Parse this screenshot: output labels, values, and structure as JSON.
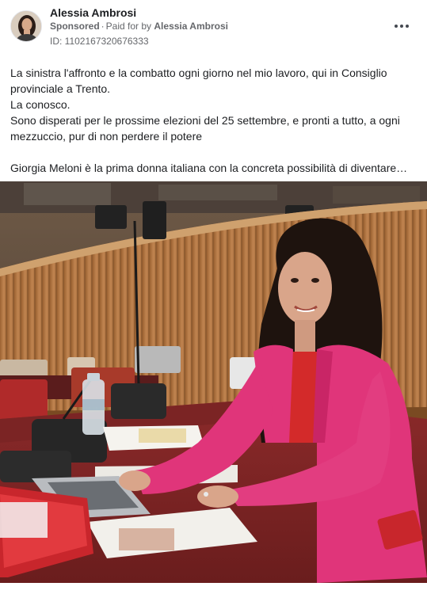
{
  "post": {
    "author": "Alessia Ambrosi",
    "sponsored_label": "Sponsored",
    "paid_for_prefix": "Paid for by",
    "paid_for_name": "Alessia Ambrosi",
    "ad_id": "ID: 1102167320676333",
    "more_icon": "more-horizontal-icon",
    "text_lines": [
      "La sinistra l'affronto e la combatto ogni giorno nel mio lavoro, qui in Consiglio",
      "provinciale a Trento.",
      "La conosco.",
      "Sono disperati per le prossime elezioni del 25 settembre, e pronti a tutto, a ogni",
      "mezzuccio, pur di non perdere il potere",
      "Giorgia Meloni è la prima donna italiana con la concreta possibilità di diventare…"
    ]
  },
  "colors": {
    "text_primary": "#1c1e21",
    "text_secondary": "#65676b",
    "jacket": "#e0357a",
    "wood": "#b47a45"
  }
}
